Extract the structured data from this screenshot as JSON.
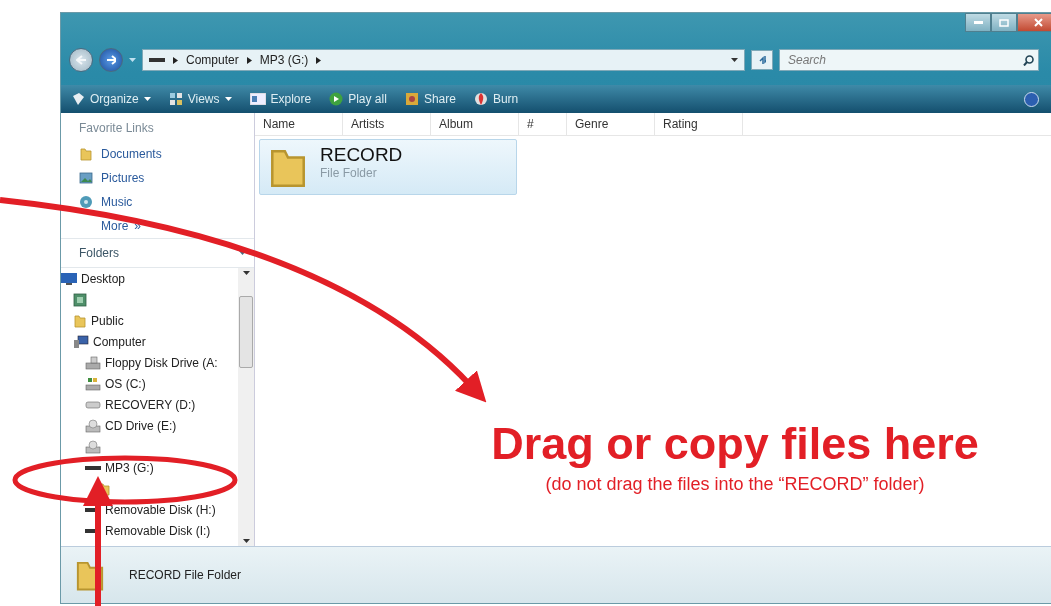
{
  "address_bar": {
    "crumbs": [
      "Computer",
      "MP3 (G:)"
    ]
  },
  "search": {
    "placeholder": "Search"
  },
  "toolbar": [
    {
      "label": "Organize",
      "kind": "organize",
      "dropdown": true
    },
    {
      "label": "Views",
      "kind": "views",
      "dropdown": true
    },
    {
      "label": "Explore",
      "kind": "explore",
      "dropdown": false
    },
    {
      "label": "Play all",
      "kind": "play",
      "dropdown": false
    },
    {
      "label": "Share",
      "kind": "share",
      "dropdown": false
    },
    {
      "label": "Burn",
      "kind": "burn",
      "dropdown": false
    }
  ],
  "favorite_links": {
    "title": "Favorite Links",
    "items": [
      {
        "label": "Documents",
        "kind": "documents"
      },
      {
        "label": "Pictures",
        "kind": "pictures"
      },
      {
        "label": "Music",
        "kind": "music"
      }
    ],
    "more": {
      "label": "More",
      "glyph": "»"
    }
  },
  "folders": {
    "title": "Folders",
    "tree": [
      {
        "label": "Desktop",
        "kind": "desktop",
        "children": [
          {
            "kind": "user"
          },
          {
            "label": "Public",
            "kind": "folder"
          },
          {
            "label": "Computer",
            "kind": "computer",
            "children": [
              {
                "label": "Floppy Disk Drive (A:",
                "kind": "floppy"
              },
              {
                "label": "OS (C:)",
                "kind": "os"
              },
              {
                "label": "RECOVERY (D:)",
                "kind": "disk"
              },
              {
                "label": "CD Drive (E:)",
                "kind": "cd"
              },
              {
                "kind": "cd"
              },
              {
                "label": "MP3 (G:)",
                "kind": "removable",
                "children": [
                  {
                    "kind": "folder"
                  }
                ]
              },
              {
                "label": "Removable Disk (H:)",
                "kind": "removable"
              },
              {
                "label": "Removable Disk (I:)",
                "kind": "removable"
              }
            ]
          }
        ]
      }
    ]
  },
  "columns": [
    "Name",
    "Artists",
    "Album",
    "#",
    "Genre",
    "Rating"
  ],
  "items": [
    {
      "name": "RECORD",
      "type": "File Folder",
      "selected": true
    }
  ],
  "status_bar": {
    "text": "RECORD File Folder"
  },
  "annotation": {
    "title": "Drag or copy files here",
    "note": "(do not drag the files into the “RECORD” folder)"
  }
}
